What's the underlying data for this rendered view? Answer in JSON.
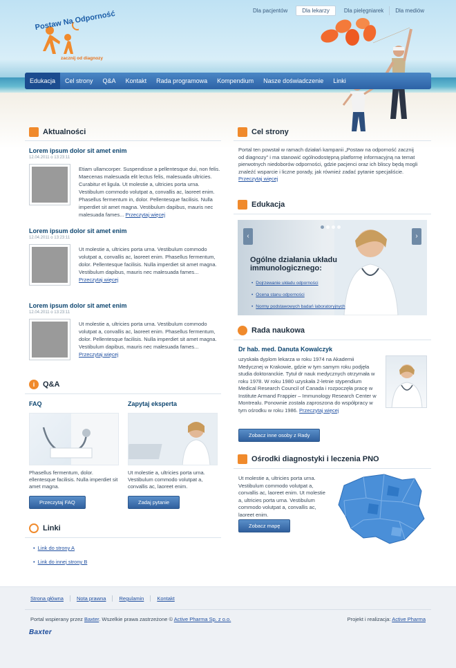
{
  "header": {
    "toplinks": [
      "Dla pacjentów",
      "Dla lekarzy",
      "Dla pielęgniarek",
      "Dla mediów"
    ],
    "logo_title": "Postaw Na Odporność",
    "logo_tagline": "zacznij od diagnozy"
  },
  "nav": [
    "Edukacja",
    "Cel strony",
    "Q&A",
    "Kontakt",
    "Rada programowa",
    "Kompendium",
    "Nasze doświadczenie",
    "Linki"
  ],
  "news": {
    "title": "Aktualności",
    "items": [
      {
        "heading": "Lorem ipsum dolor sit amet enim",
        "date": "12.04.2011 o 13:23:11",
        "body": "Etiam ullamcorper. Suspendisse a pellentesque dui, non felis. Maecenas malesuada elit lectus felis, malesuada ultricies. Curabitur et ligula. Ut molestie a, ultricies porta urna. Vestibulum commodo volutpat a, convallis ac, laoreet enim. Phasellus fermentum in, dolor. Pellentesque facilisis. Nulla imperdiet sit amet magna. Vestibulum dapibus, mauris nec malesuada fames...",
        "more": "Przeczytaj więcej"
      },
      {
        "heading": "Lorem ipsum dolor sit amet enim",
        "date": "12.04.2011 o 13:23:11",
        "body": "Ut molestie a, ultricies porta urna. Vestibulum commodo volutpat a, convallis ac, laoreet enim. Phasellus fermentum, dolor. Pellentesque facilisis. Nulla imperdiet sit amet magna. Vestibulum dapibus, mauris nec malesuada fames...",
        "more": "Przeczytaj więcej"
      },
      {
        "heading": "Lorem ipsum dolor sit amet enim",
        "date": "12.04.2011 o 13:23:11",
        "body": "Ut molestie a, ultricies porta urna. Vestibulum commodo volutpat a, convallis ac, laoreet enim. Phasellus fermentum, dolor. Pellentesque facilisis. Nulla imperdiet sit amet magna. Vestibulum dapibus, mauris nec malesuada fames...",
        "more": "Przeczytaj więcej"
      }
    ]
  },
  "qa": {
    "title": "Q&A",
    "faq": {
      "heading": "FAQ",
      "text": "Phasellus fermentum, dolor. ellentesque facilisis. Nulla imperdiet sit amet magna.",
      "button": "Przeczytaj FAQ"
    },
    "expert": {
      "heading": "Zapytaj eksperta",
      "text": "Ut molestie a, ultricies porta urna. Vestibulum commodo volutpat a, convallis ac, laoreet enim.",
      "button": "Zadaj pytanie"
    }
  },
  "links": {
    "title": "Linki",
    "items": [
      "Link do strony A",
      "Link do innej strony B"
    ]
  },
  "cel": {
    "title": "Cel strony",
    "text": "Portal ten powstał w ramach działań kampanii „Postaw na odporność zacznij od diagnozy\" i ma stanowić ogólnodostępną platformę informacyjną na temat pierwotnych niedoborów odporności, gdzie pacjenci oraz ich bliscy będą mogli znaleźć wsparcie i liczne porady, jak również zadać pytanie specjaliście.",
    "more": "Przeczytaj więcej"
  },
  "edukacja": {
    "title": "Edukacja",
    "slide_title": "Ogólne działania układu immunologicznego:",
    "links": [
      "Dojrzewanie układu odporności",
      "Ocena stanu odporności",
      "Normy podstawowych badań laboratoryjnych"
    ]
  },
  "rada": {
    "title": "Rada naukowa",
    "name": "Dr hab. med. Danuta Kowalczyk",
    "bio": "uzyskała dyplom lekarza w roku 1974 na Akademii Medycznej w Krakowie, gdzie w tym samym roku podjęła studia doktoranckie. Tytuł dr nauk medycznych otrzymała w roku 1978. W roku 1980 uzyskała 2-letnie stypendium Medical Research Council of Canada i rozpoczęła pracę w Institute Armand Frappier – Immunology Research Center w Montrealu. Ponownie została zaproszona do współpracy w tym ośrodku w roku 1986.",
    "more": "Przeczytaj więcej",
    "button": "Zobacz inne osoby z Rady"
  },
  "osrodki": {
    "title": "Ośrodki diagnostyki i leczenia PNO",
    "text": "Ut molestie a, ultricies porta urna. Vestibulum commodo volutpat a, convallis ac, laoreet enim. Ut molestie a, ultricies porta urna. Vestibulum commodo volutpat a, convallis ac, laoreet enim.",
    "button": "Zobacz mapę"
  },
  "footer": {
    "nav": [
      "Strona główna",
      "Nota prawna",
      "Regulamin",
      "Kontakt"
    ],
    "left_prefix": "Portal wspierany przez",
    "left_link1": "Baxter",
    "left_mid": ". Wszelkie prawa zastrzeżone ©",
    "left_link2": "Active Pharma Sp. z o.o.",
    "right_prefix": "Projekt i realizacja:",
    "right_link": "Active Pharma",
    "brand": "Baxter"
  },
  "colors": {
    "accent": "#f08a2c",
    "nav": "#2d62a6",
    "link": "#1f4fa0",
    "heading": "#0e4670"
  }
}
